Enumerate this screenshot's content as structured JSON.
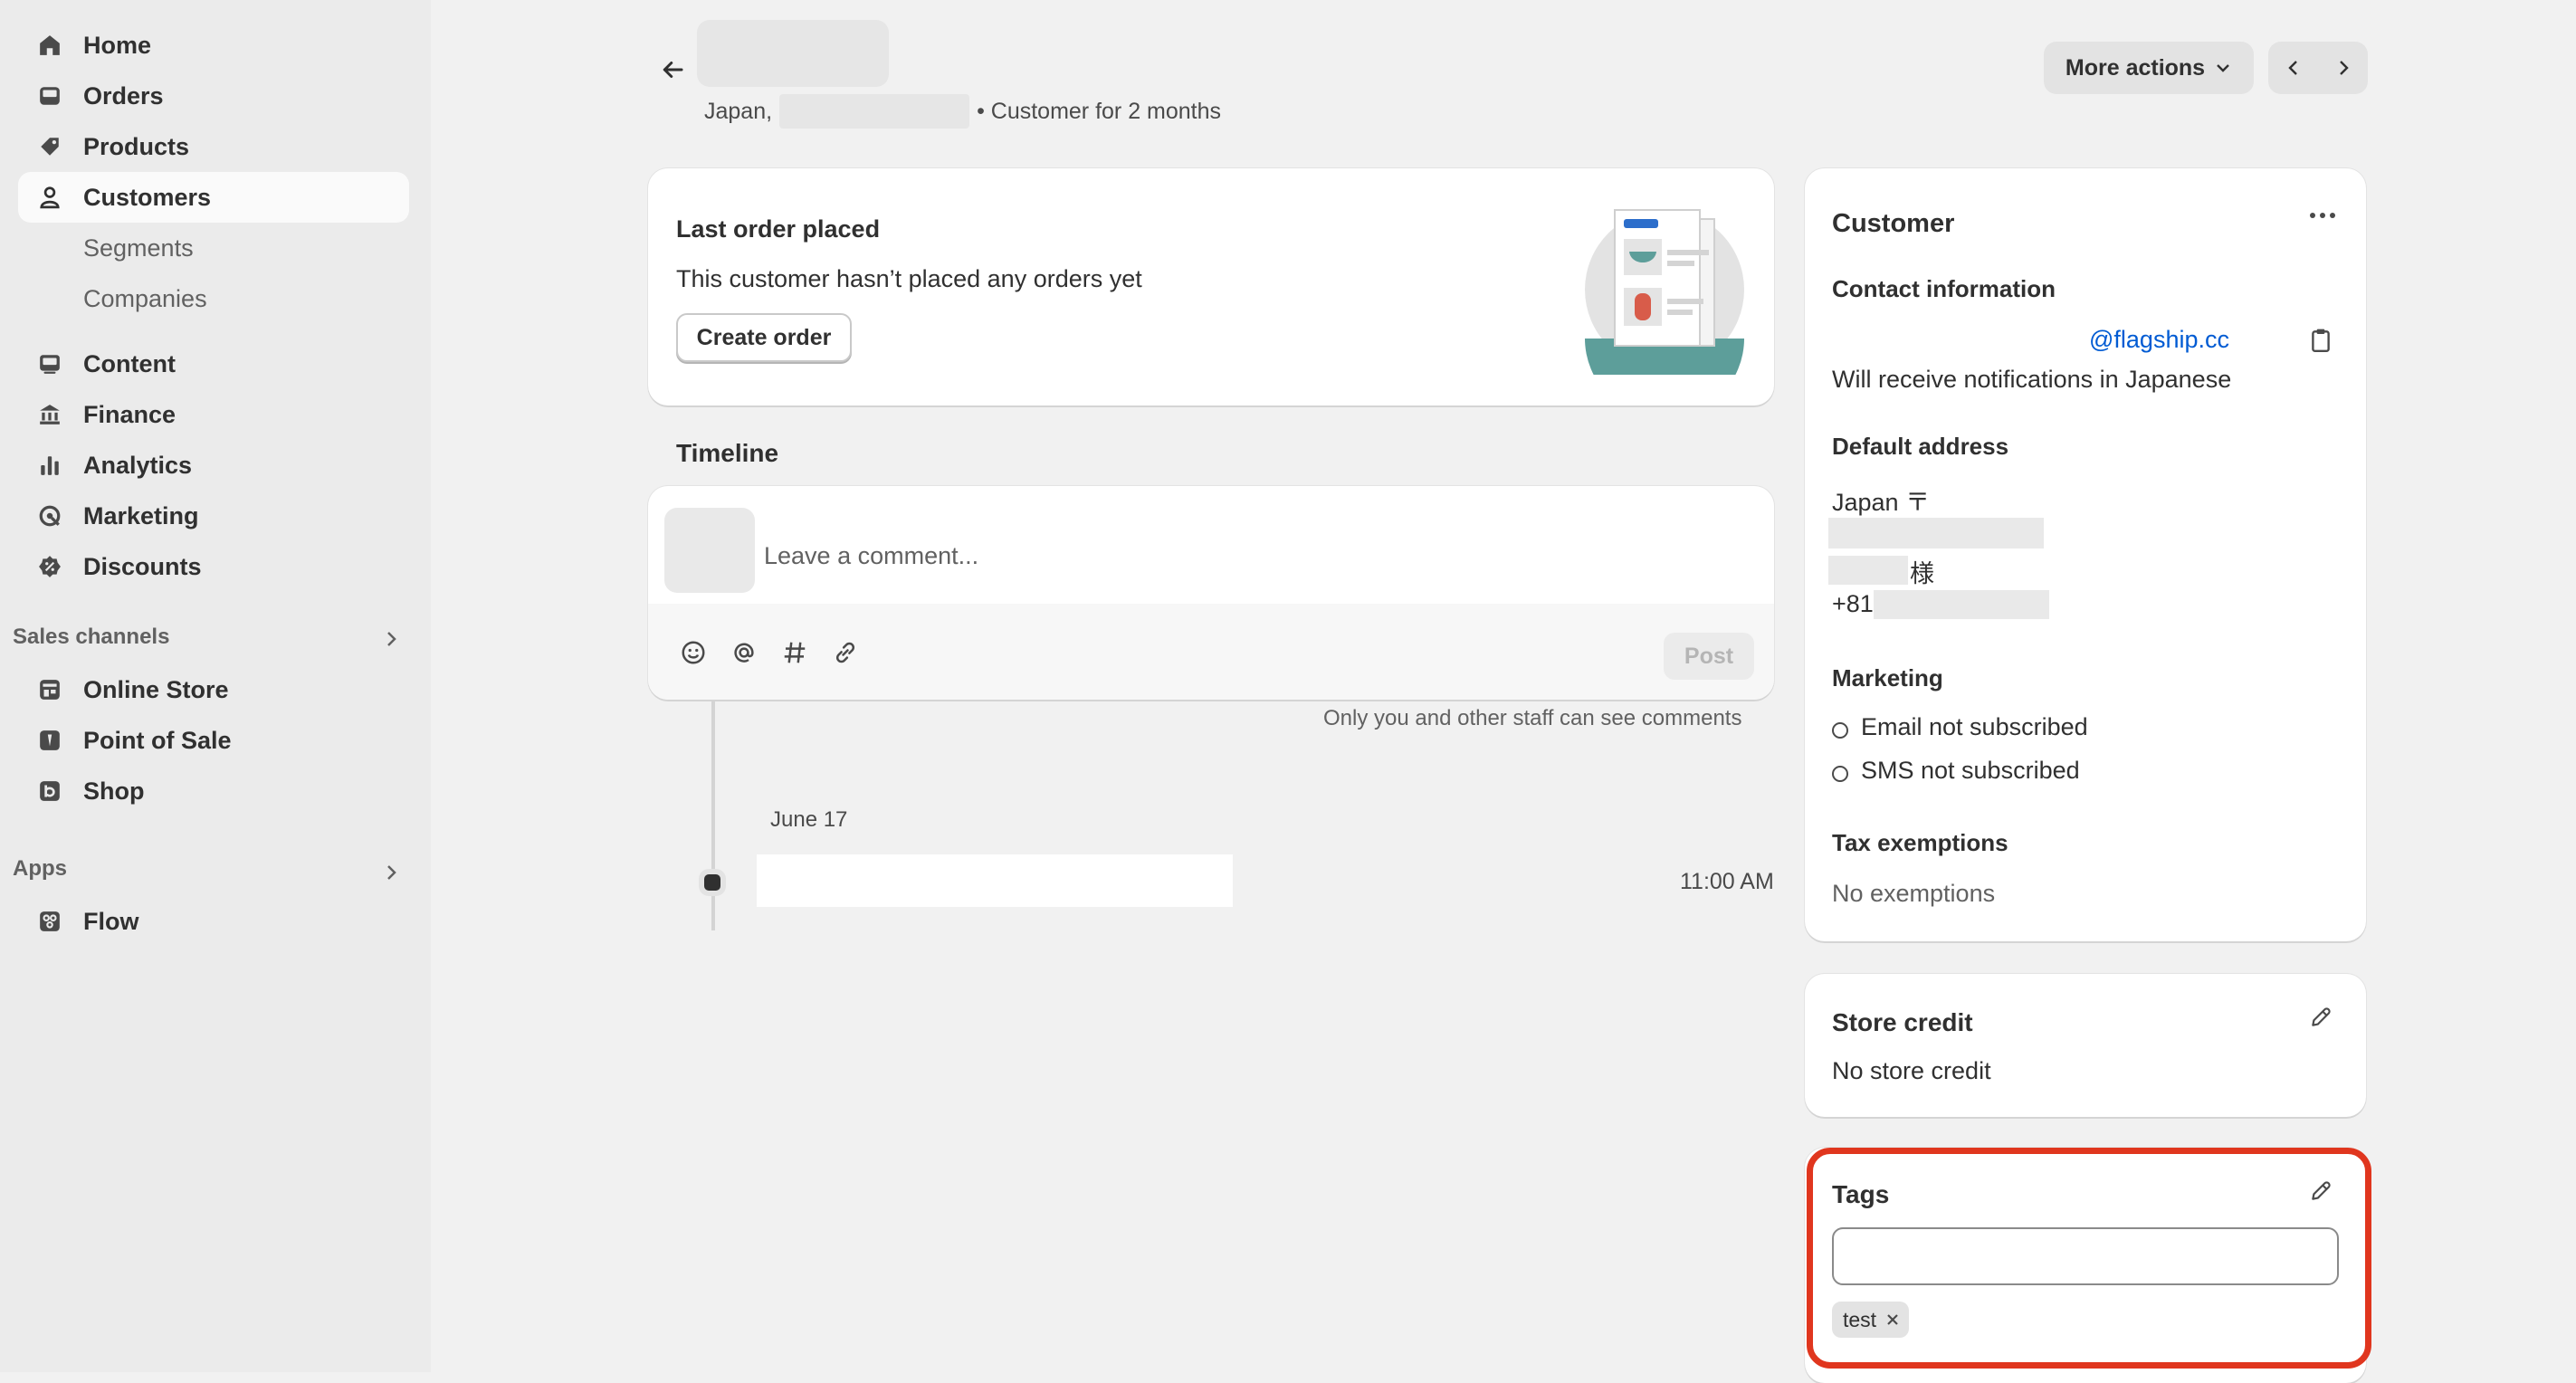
{
  "sidebar": {
    "main_items": [
      {
        "label": "Home",
        "icon": "home-icon"
      },
      {
        "label": "Orders",
        "icon": "inbox-icon"
      },
      {
        "label": "Products",
        "icon": "tag-icon"
      },
      {
        "label": "Customers",
        "icon": "person-icon"
      }
    ],
    "customer_sub": [
      "Segments",
      "Companies"
    ],
    "more_items": [
      {
        "label": "Content",
        "icon": "image-icon"
      },
      {
        "label": "Finance",
        "icon": "bank-icon"
      },
      {
        "label": "Analytics",
        "icon": "bar-chart-icon"
      },
      {
        "label": "Marketing",
        "icon": "target-icon"
      },
      {
        "label": "Discounts",
        "icon": "discount-icon"
      }
    ],
    "sales_channels_label": "Sales channels",
    "sales_channels": [
      {
        "label": "Online Store",
        "icon": "store-icon"
      },
      {
        "label": "Point of Sale",
        "icon": "pos-icon"
      },
      {
        "label": "Shop",
        "icon": "shop-icon"
      }
    ],
    "apps_label": "Apps",
    "apps": [
      {
        "label": "Flow",
        "icon": "flow-icon"
      }
    ]
  },
  "header": {
    "country": "Japan,",
    "customer_since": "• Customer for 2 months",
    "more_actions_label": "More actions"
  },
  "last_order": {
    "title": "Last order placed",
    "message": "This customer hasn’t placed any orders yet",
    "create_order_label": "Create order"
  },
  "timeline": {
    "title": "Timeline",
    "comment_placeholder": "Leave a comment...",
    "post_label": "Post",
    "staff_note": "Only you and other staff can see comments",
    "date": "June 17",
    "event_time": "11:00 AM"
  },
  "customer_card": {
    "title": "Customer",
    "contact_heading": "Contact information",
    "email": "@flagship.cc",
    "notifications": "Will receive notifications in Japanese",
    "address_heading": "Default address",
    "address_line1": "Japan 〒",
    "address_honorific": "様",
    "phone_prefix": "+81",
    "marketing_heading": "Marketing",
    "email_status": "Email not subscribed",
    "sms_status": "SMS not subscribed",
    "tax_heading": "Tax exemptions",
    "tax_value": "No exemptions"
  },
  "store_credit": {
    "title": "Store credit",
    "value": "No store credit"
  },
  "tags": {
    "title": "Tags",
    "input_value": "",
    "items": [
      "test"
    ]
  },
  "colors": {
    "accent_link": "#005bd3",
    "highlight_border": "#e0361e",
    "sidebar_bg": "#ebebeb",
    "page_bg": "#f1f1f1"
  }
}
